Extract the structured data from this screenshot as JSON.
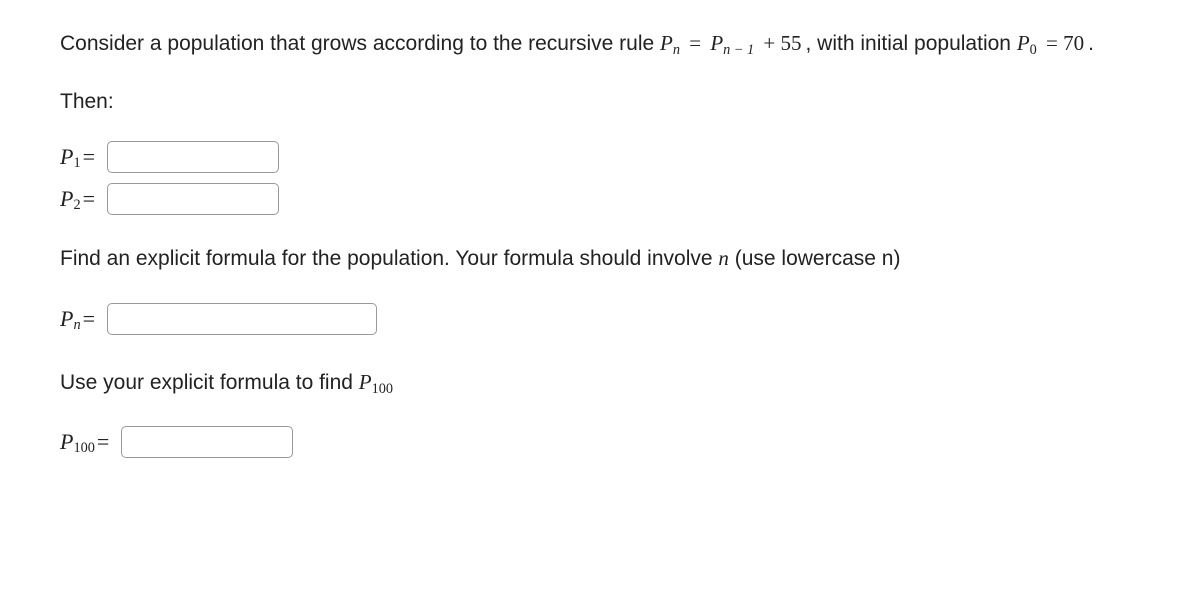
{
  "problem": {
    "intro_part1": "Consider a population that grows according to the recursive rule ",
    "rule_lhs_base": "P",
    "rule_lhs_sub": "n",
    "rule_eq": "=",
    "rule_rhs_base": "P",
    "rule_rhs_sub": "n − 1",
    "rule_rhs_plus": "+ 55",
    "intro_part2": ", with initial population ",
    "init_base": "P",
    "init_sub": "0",
    "init_eq": "= 70",
    "intro_part3": "."
  },
  "then_label": "Then:",
  "p1": {
    "base": "P",
    "sub": "1",
    "value": ""
  },
  "p2": {
    "base": "P",
    "sub": "2",
    "value": ""
  },
  "explicit_prompt_part1": "Find an explicit formula for the population. Your formula should involve ",
  "explicit_prompt_n": "n",
  "explicit_prompt_part2": " (use lowercase n)",
  "pn": {
    "base": "P",
    "sub": "n",
    "value": ""
  },
  "use_formula_part1": "Use your explicit formula to find ",
  "p100_label_base": "P",
  "p100_label_sub": "100",
  "p100": {
    "base": "P",
    "sub": "100",
    "value": ""
  }
}
